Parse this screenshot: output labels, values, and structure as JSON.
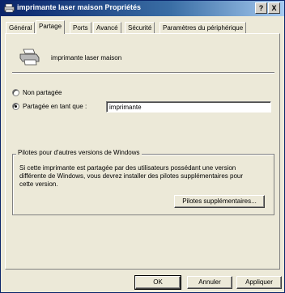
{
  "window": {
    "title": "imprimante laser maison Propriétés",
    "help_label": "?",
    "close_label": "X"
  },
  "tabs": [
    {
      "label": "Général"
    },
    {
      "label": "Partage"
    },
    {
      "label": "Ports"
    },
    {
      "label": "Avancé"
    },
    {
      "label": "Sécurité"
    },
    {
      "label": "Paramètres du périphérique"
    }
  ],
  "active_tab": "Partage",
  "printer": {
    "name": "imprimante laser maison"
  },
  "sharing": {
    "not_shared_label": "Non partagée",
    "shared_as_label": "Partagée en tant que :",
    "selected": "shared",
    "share_name": "imprimante"
  },
  "drivers": {
    "group_title": "Pilotes pour d'autres versions de Windows",
    "description": "Si cette imprimante est partagée par des utilisateurs possédant une version différente de Windows, vous devrez installer des pilotes supplémentaires pour cette version.",
    "button_label": "Pilotes supplémentaires..."
  },
  "footer": {
    "ok_label": "OK",
    "cancel_label": "Annuler",
    "apply_label": "Appliquer"
  }
}
